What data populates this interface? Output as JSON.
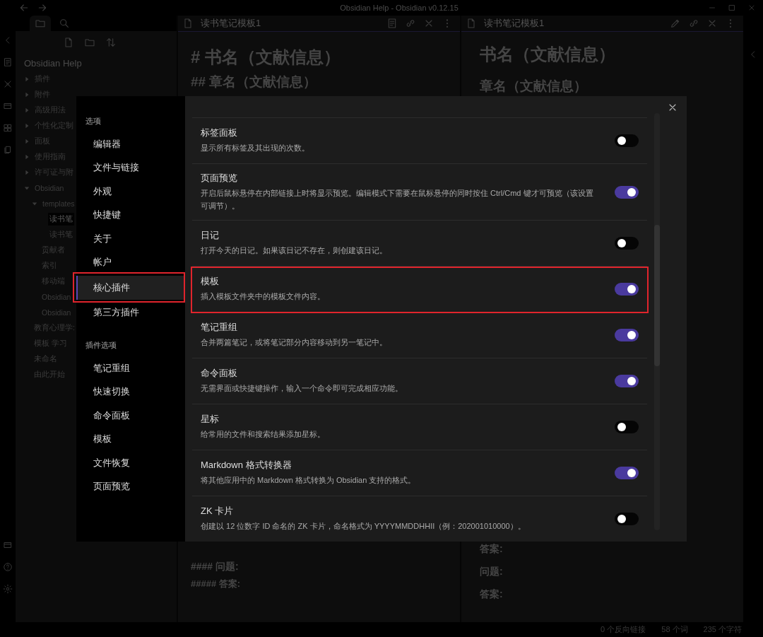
{
  "window": {
    "title": "Obsidian Help - Obsidian v0.12.15"
  },
  "explorer": {
    "tabs": [
      {
        "kind": "files",
        "selected": true
      },
      {
        "kind": "search",
        "selected": false
      }
    ],
    "vault": "Obsidian Help",
    "tree": [
      {
        "label": "插件",
        "kind": "folder",
        "expanded": false,
        "selected": false
      },
      {
        "label": "附件",
        "kind": "folder",
        "expanded": false,
        "selected": false
      },
      {
        "label": "高级用法",
        "kind": "folder",
        "expanded": false,
        "selected": false
      },
      {
        "label": "个性化定制",
        "kind": "folder",
        "expanded": false,
        "selected": false
      },
      {
        "label": "面板",
        "kind": "folder",
        "expanded": false,
        "selected": false
      },
      {
        "label": "使用指南",
        "kind": "folder",
        "expanded": false,
        "selected": false
      },
      {
        "label": "许可证与附",
        "kind": "folder",
        "expanded": false,
        "selected": false
      },
      {
        "label": "Obsidian",
        "kind": "folder",
        "expanded": true,
        "selected": false,
        "children": [
          {
            "label": "templates",
            "kind": "folder",
            "expanded": true,
            "selected": false,
            "children": [
              {
                "label": "读书笔",
                "kind": "file",
                "selected": true
              },
              {
                "label": "读书笔",
                "kind": "file",
                "selected": false
              }
            ]
          },
          {
            "label": "贡献者",
            "kind": "file",
            "selected": false
          },
          {
            "label": "索引",
            "kind": "file",
            "selected": false
          },
          {
            "label": "移动端",
            "kind": "file",
            "selected": false
          },
          {
            "label": "Obsidian",
            "kind": "file",
            "selected": false
          },
          {
            "label": "Obsidian",
            "kind": "file",
            "selected": false
          }
        ]
      },
      {
        "label": "教育心理学:",
        "kind": "file",
        "selected": false
      },
      {
        "label": "模板 学习",
        "kind": "file",
        "selected": false
      },
      {
        "label": "未命名",
        "kind": "file",
        "selected": false
      },
      {
        "label": "由此开始",
        "kind": "file",
        "selected": false
      }
    ]
  },
  "editors": [
    {
      "title": "读书笔记模板1",
      "top_lines": [
        {
          "kind": "h1",
          "text": "# 书名（文献信息）"
        },
        {
          "kind": "h2",
          "text": "## 章名（文献信息）"
        }
      ],
      "bottom_lines": [
        {
          "kind": "h4",
          "text": "#### 问题:"
        },
        {
          "kind": "h5",
          "text": "##### 答案:"
        }
      ]
    },
    {
      "title": "读书笔记模板1",
      "top_lines": [
        {
          "kind": "h1",
          "text": "书名（文献信息）"
        },
        {
          "kind": "h2",
          "text": "章名（文献信息）"
        }
      ],
      "bottom_lines": [
        {
          "kind": "h4",
          "text": "答案:"
        },
        {
          "kind": "h4",
          "text": "问题:"
        },
        {
          "kind": "h4",
          "text": "答案:"
        }
      ]
    }
  ],
  "status_bar": [
    "0 个反向链接",
    "58 个词",
    "235 个字符"
  ],
  "settings": {
    "nav": [
      {
        "heading": "选项",
        "items": [
          {
            "label": "编辑器",
            "selected": false,
            "highlighted": false
          },
          {
            "label": "文件与链接",
            "selected": false,
            "highlighted": false
          },
          {
            "label": "外观",
            "selected": false,
            "highlighted": false
          },
          {
            "label": "快捷键",
            "selected": false,
            "highlighted": false
          },
          {
            "label": "关于",
            "selected": false,
            "highlighted": false
          },
          {
            "label": "帐户",
            "selected": false,
            "highlighted": false
          },
          {
            "label": "核心插件",
            "selected": true,
            "highlighted": true
          },
          {
            "label": "第三方插件",
            "selected": false,
            "highlighted": false
          }
        ]
      },
      {
        "heading": "插件选项",
        "items": [
          {
            "label": "笔记重组",
            "selected": false,
            "highlighted": false
          },
          {
            "label": "快速切换",
            "selected": false,
            "highlighted": false
          },
          {
            "label": "命令面板",
            "selected": false,
            "highlighted": false
          },
          {
            "label": "模板",
            "selected": false,
            "highlighted": false
          },
          {
            "label": "文件恢复",
            "selected": false,
            "highlighted": false
          },
          {
            "label": "页面预览",
            "selected": false,
            "highlighted": false
          }
        ]
      }
    ],
    "plugins": [
      {
        "name": "标签面板",
        "description": "显示所有标签及其出现的次数。",
        "enabled": false,
        "highlighted": false
      },
      {
        "name": "页面预览",
        "description": "开启后鼠标悬停在内部链接上时将显示预览。编辑模式下需要在鼠标悬停的同时按住 Ctrl/Cmd 键才可预览（该设置可调节）。",
        "enabled": true,
        "highlighted": false
      },
      {
        "name": "日记",
        "description": "打开今天的日记。如果该日记不存在，则创建该日记。",
        "enabled": false,
        "highlighted": false
      },
      {
        "name": "模板",
        "description": "插入模板文件夹中的模板文件内容。",
        "enabled": true,
        "highlighted": true
      },
      {
        "name": "笔记重组",
        "description": "合并两篇笔记，或将笔记部分内容移动到另一笔记中。",
        "enabled": true,
        "highlighted": false
      },
      {
        "name": "命令面板",
        "description": "无需界面或快捷键操作，输入一个命令即可完成相应功能。",
        "enabled": true,
        "highlighted": false
      },
      {
        "name": "星标",
        "description": "给常用的文件和搜索结果添加星标。",
        "enabled": false,
        "highlighted": false
      },
      {
        "name": "Markdown 格式转换器",
        "description": "将其他应用中的 Markdown 格式转换为 Obsidian 支持的格式。",
        "enabled": true,
        "highlighted": false
      },
      {
        "name": "ZK 卡片",
        "description": "创建以 12 位数字 ID 命名的 ZK 卡片，命名格式为 YYYYMMDDHHII（例：202001010000）。",
        "enabled": false,
        "highlighted": false
      }
    ]
  }
}
